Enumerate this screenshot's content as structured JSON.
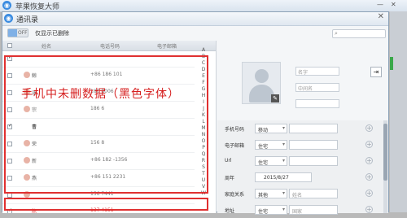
{
  "app": {
    "title": "苹果恢复大师",
    "minimize": "—",
    "close": "✕"
  },
  "dialog": {
    "title": "通讯录",
    "close": "✕",
    "toggle_label": "OFF",
    "show_deleted": "仅显示已删除",
    "search_placeholder": ""
  },
  "list": {
    "headers": {
      "name": "姓名",
      "phone": "电话号码",
      "email": "电子邮箱"
    },
    "rows": [
      {
        "name": "",
        "phone": "",
        "checked": true
      },
      {
        "name": "鲸",
        "phone": "+86 186          101",
        "checked": false
      },
      {
        "name": "涵",
        "phone": "180          8006",
        "checked": false
      },
      {
        "name": "宗",
        "phone": "186          6",
        "checked": false
      },
      {
        "name": "曹",
        "phone": "",
        "checked": true
      },
      {
        "name": "荣",
        "phone": "156          8",
        "checked": false
      },
      {
        "name": "新",
        "phone": "+86 182          -1356",
        "checked": false
      },
      {
        "name": "燕",
        "phone": "+86 151          2231",
        "checked": false
      },
      {
        "name": "",
        "phone": "156          7441",
        "checked": false
      },
      {
        "name": "陈",
        "phone": "137          4151",
        "checked": true
      }
    ],
    "alphabet": [
      "A",
      "B",
      "C",
      "D",
      "E",
      "F",
      "G",
      "H",
      "I",
      "J",
      "K",
      "L",
      "M",
      "N",
      "O",
      "P",
      "Q",
      "R",
      "S",
      "T",
      "U",
      "V",
      "W"
    ]
  },
  "annotation": {
    "text": "手机中未删数据（黑色字体）"
  },
  "detail": {
    "name_fields": [
      "名字",
      "中间名",
      ""
    ],
    "photo_edit_icon": "✎",
    "export_icon": "⇥",
    "form": [
      {
        "label": "手机号码",
        "select": "移动",
        "value": ""
      },
      {
        "label": "电子邮箱",
        "select": "住宅",
        "value": ""
      },
      {
        "label": "Url",
        "select": "住宅",
        "value": ""
      },
      {
        "label": "周年",
        "select": "",
        "value": "2015/8/27"
      },
      {
        "label": "家庭关系",
        "select": "其他",
        "value": "姓名"
      },
      {
        "label": "地址",
        "select": "住宅",
        "value": "国家"
      }
    ]
  }
}
